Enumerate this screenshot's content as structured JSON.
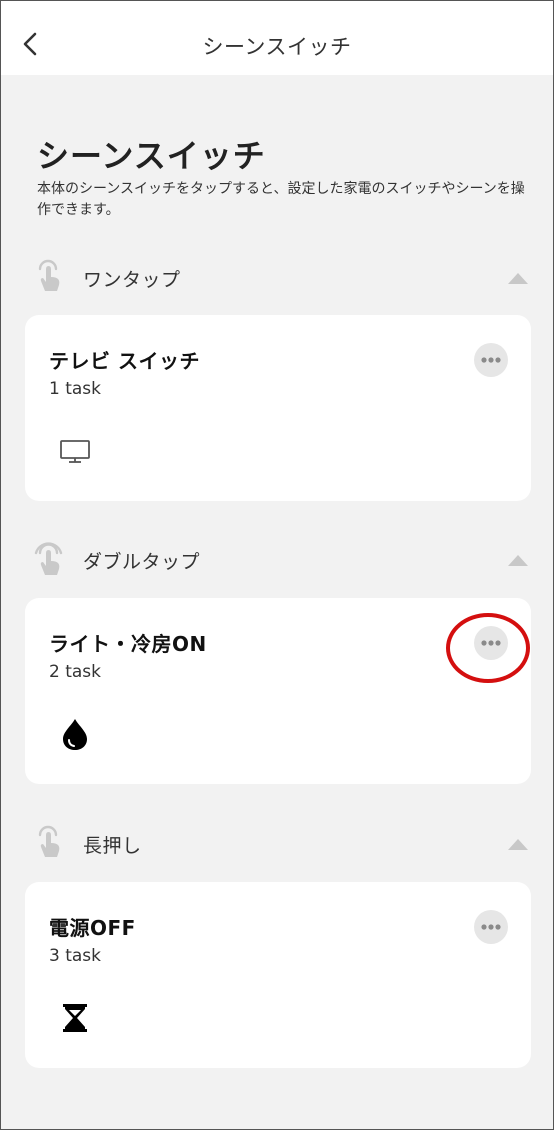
{
  "nav": {
    "title": "シーンスイッチ",
    "back_icon": "chevron-left-icon"
  },
  "page": {
    "title": "シーンスイッチ",
    "description": "本体のシーンスイッチをタップすると、設定した家電のスイッチやシーンを操作できます。"
  },
  "sections": [
    {
      "label": "ワンタップ",
      "icon": "single-tap-icon",
      "card": {
        "title": "テレビ スイッチ",
        "subtitle": "1 task",
        "icon": "tv-icon"
      }
    },
    {
      "label": "ダブルタップ",
      "icon": "double-tap-icon",
      "card": {
        "title": "ライト・冷房ON",
        "subtitle": "2 task",
        "icon": "water-drop-icon"
      }
    },
    {
      "label": "長押し",
      "icon": "long-press-icon",
      "card": {
        "title": "電源OFF",
        "subtitle": "3 task",
        "icon": "hourglass-icon"
      }
    }
  ],
  "colors": {
    "background": "#f2f2f2",
    "card": "#ffffff",
    "highlight": "#d40f0f"
  }
}
